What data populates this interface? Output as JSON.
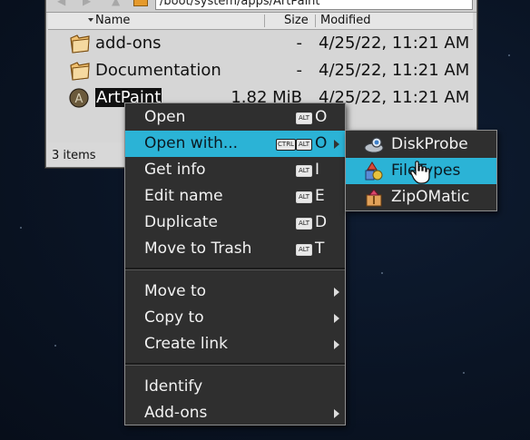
{
  "window": {
    "path": "/boot/system/apps/ArtPaint",
    "columns": {
      "name": "Name",
      "size": "Size",
      "modified": "Modified"
    },
    "files": [
      {
        "name": "add-ons",
        "size": "-",
        "modified": "4/25/22, 11:21 AM",
        "icon": "folder-icon"
      },
      {
        "name": "Documentation",
        "size": "-",
        "modified": "4/25/22, 11:21 AM",
        "icon": "folder-icon"
      },
      {
        "name": "ArtPaint",
        "size": "1.82 MiB",
        "modified": "4/25/22, 11:21 AM",
        "icon": "artpaint-app-icon",
        "selected": true
      }
    ],
    "status": "3 items"
  },
  "context_menu": {
    "items": [
      {
        "label": "Open",
        "modifiers": [
          "ALT"
        ],
        "shortcut": "O"
      },
      {
        "label": "Open with...",
        "modifiers": [
          "CTRL",
          "ALT"
        ],
        "shortcut": "O",
        "submenu": true,
        "highlighted": true
      },
      {
        "label": "Get info",
        "modifiers": [
          "ALT"
        ],
        "shortcut": "I"
      },
      {
        "label": "Edit name",
        "modifiers": [
          "ALT"
        ],
        "shortcut": "E"
      },
      {
        "label": "Duplicate",
        "modifiers": [
          "ALT"
        ],
        "shortcut": "D"
      },
      {
        "label": "Move to Trash",
        "modifiers": [
          "ALT"
        ],
        "shortcut": "T"
      },
      {
        "label": "Move to",
        "submenu": true
      },
      {
        "label": "Copy to",
        "submenu": true
      },
      {
        "label": "Create link",
        "submenu": true
      },
      {
        "label": "Identify"
      },
      {
        "label": "Add-ons",
        "submenu": true
      }
    ]
  },
  "open_with_submenu": {
    "items": [
      {
        "label": "DiskProbe",
        "icon": "diskprobe-icon"
      },
      {
        "label": "FileTypes",
        "icon": "filetypes-icon",
        "highlighted": true
      },
      {
        "label": "ZipOMatic",
        "icon": "zipomatic-icon"
      }
    ]
  },
  "colors": {
    "highlight": "#2bb3d6",
    "menu_bg": "#2f2f2f",
    "desktop": "#0a1424"
  }
}
